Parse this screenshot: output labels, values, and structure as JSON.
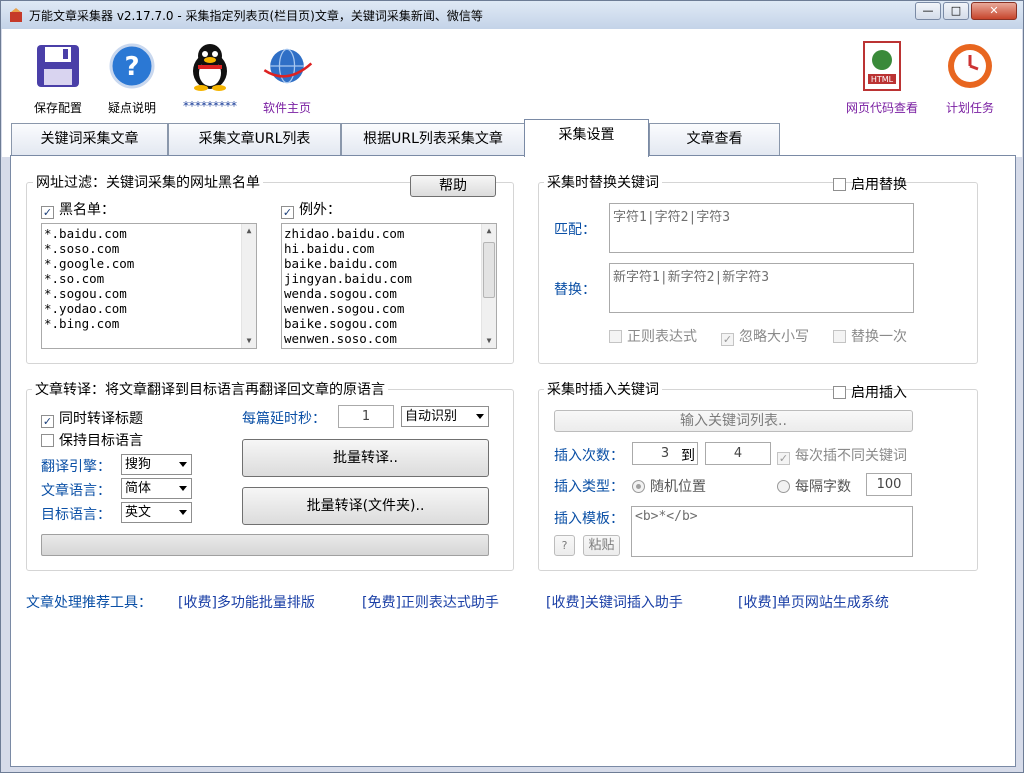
{
  "window": {
    "title": "万能文章采集器 v2.17.7.0 - 采集指定列表页(栏目页)文章，关键词采集新闻、微信等",
    "min": "—",
    "max": "□",
    "close": "✕"
  },
  "toolbar": {
    "save": "保存配置",
    "help": "疑点说明",
    "qq": "*********",
    "home": "软件主页",
    "html_view": "网页代码查看",
    "schedule": "计划任务"
  },
  "tabs": [
    "关键词采集文章",
    "采集文章URL列表",
    "根据URL列表采集文章",
    "采集设置",
    "文章查看"
  ],
  "url_filter": {
    "title": "网址过滤：关键词采集的网址黑名单",
    "help_button": "帮助",
    "blacklist_label": "黑名单：",
    "blacklist_checked": true,
    "blacklist": [
      "*.baidu.com",
      "*.soso.com",
      "*.google.com",
      "*.so.com",
      "*.sogou.com",
      "*.yodao.com",
      "*.bing.com"
    ],
    "exception_label": "例外：",
    "exception_checked": true,
    "exceptions": [
      "zhidao.baidu.com",
      "hi.baidu.com",
      "baike.baidu.com",
      "jingyan.baidu.com",
      "wenda.sogou.com",
      "wenwen.sogou.com",
      "baike.sogou.com",
      "wenwen.soso.com"
    ]
  },
  "replace_kw": {
    "title": "采集时替换关键词",
    "enable_label": "启用替换",
    "match_label": "匹配：",
    "match_value": "字符1|字符2|字符3",
    "replace_label": "替换：",
    "replace_value": "新字符1|新字符2|新字符3",
    "regex_label": "正则表达式",
    "ignore_case_label": "忽略大小写",
    "replace_once_label": "替换一次"
  },
  "translate": {
    "title": "文章转译：将文章翻译到目标语言再翻译回文章的原语言",
    "sync_title_label": "同时转译标题",
    "keep_target_label": "保持目标语言",
    "delay_label": "每篇延时秒：",
    "delay_value": "1",
    "detect_value": "自动识别",
    "engine_label": "翻译引擎：",
    "engine_value": "搜狗",
    "lang_label": "文章语言：",
    "lang_value": "简体",
    "target_label": "目标语言：",
    "target_value": "英文",
    "batch_button": "批量转译..",
    "batch_folder_button": "批量转译(文件夹).."
  },
  "insert_kw": {
    "title": "采集时插入关键词",
    "enable_label": "启用插入",
    "input_list_button": "输入关键词列表..",
    "count_label": "插入次数：",
    "count_from": "3",
    "to_label": "到",
    "count_to": "4",
    "diff_kw_label": "每次插不同关键词",
    "type_label": "插入类型：",
    "random_label": "随机位置",
    "every_label": "每隔字数",
    "every_value": "100",
    "template_label": "插入模板：",
    "template_value": "<b>*</b>",
    "q_button": "?",
    "paste_button": "粘贴"
  },
  "footer": {
    "label": "文章处理推荐工具：",
    "links": [
      "[收费]多功能批量排版",
      "[免费]正则表达式助手",
      "[收费]关键词插入助手",
      "[收费]单页网站生成系统"
    ]
  },
  "colors": {
    "accent_blue": "#0b50a6",
    "purple": "#7a1fa2",
    "link": "#1a3fa6"
  }
}
